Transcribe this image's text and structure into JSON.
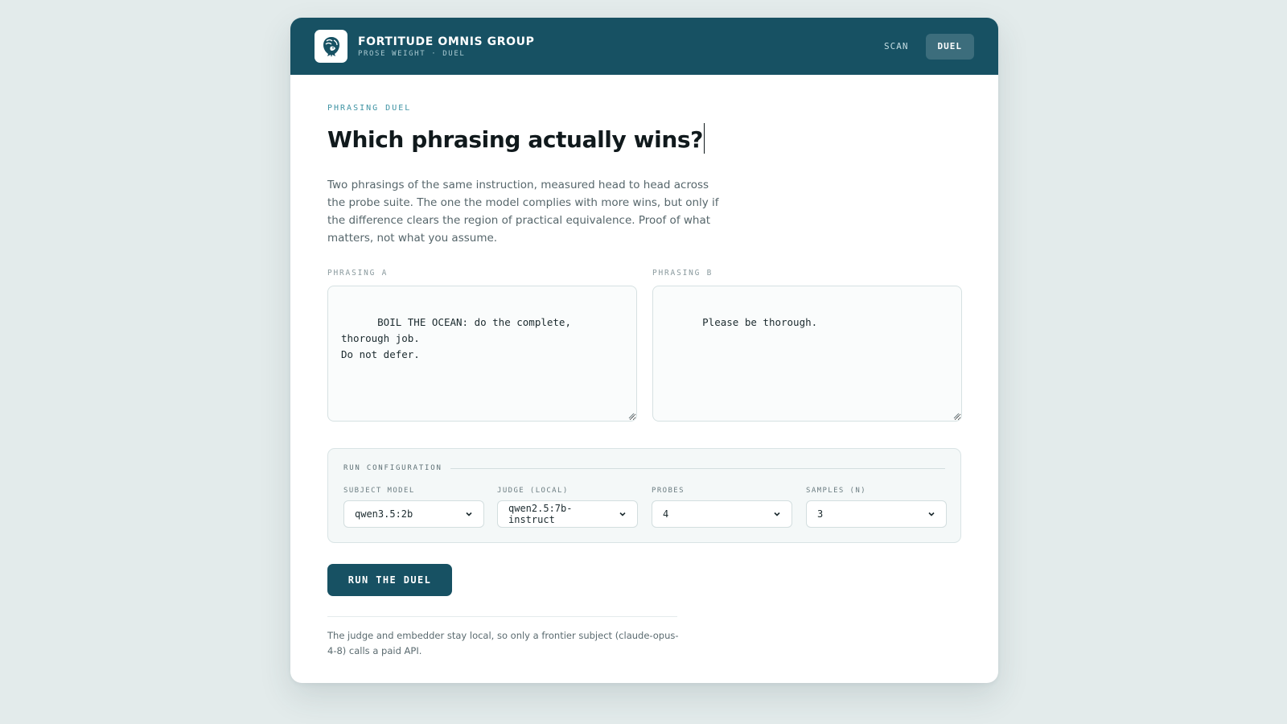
{
  "colors": {
    "background": "#e3ebeb",
    "header": "#175163",
    "accent": "#3f93a3",
    "button": "#175163"
  },
  "header": {
    "brand_name": "FORTITUDE OMNIS GROUP",
    "brand_sub": "PROSE WEIGHT · DUEL",
    "logo_icon": "lion-head-icon",
    "nav": [
      {
        "label": "SCAN",
        "active": false
      },
      {
        "label": "DUEL",
        "active": true
      }
    ]
  },
  "main": {
    "eyebrow": "PHRASING DUEL",
    "title": "Which phrasing actually wins?",
    "lede": "Two phrasings of the same instruction, measured head to head across the probe suite. The one the model complies with more wins, but only if the difference clears the region of practical equivalence. Proof of what matters, not what you assume."
  },
  "phrasing_a": {
    "label": "PHRASING A",
    "value": "BOIL THE OCEAN: do the complete, thorough job.\nDo not defer."
  },
  "phrasing_b": {
    "label": "PHRASING B",
    "value": "Please be thorough."
  },
  "config": {
    "title": "RUN CONFIGURATION",
    "fields": [
      {
        "label": "SUBJECT MODEL",
        "value": "qwen3.5:2b"
      },
      {
        "label": "JUDGE (LOCAL)",
        "value": "qwen2.5:7b-instruct"
      },
      {
        "label": "PROBES",
        "value": "4"
      },
      {
        "label": "SAMPLES (N)",
        "value": "3"
      }
    ]
  },
  "run_button": "RUN THE DUEL",
  "footnote": "The judge and embedder stay local, so only a frontier subject (claude-opus-4-8) calls a paid API."
}
